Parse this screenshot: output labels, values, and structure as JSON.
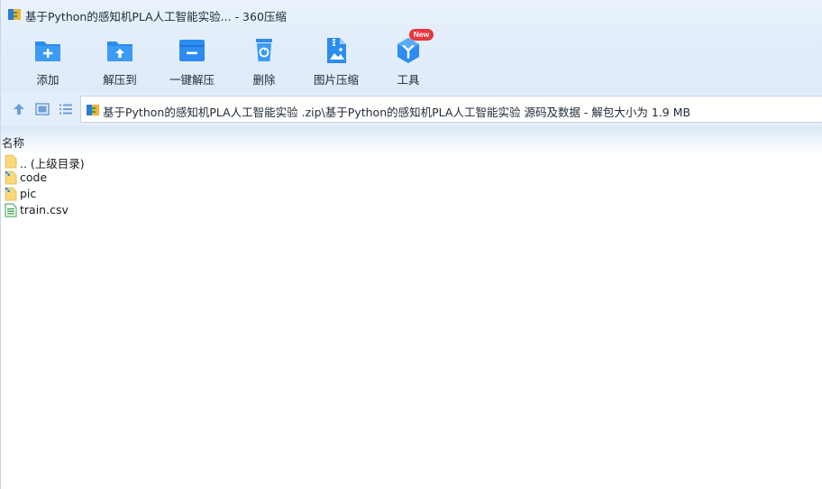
{
  "title_bar": {
    "title": "基于Python的感知机PLA人工智能实验...",
    "app_suffix": "- 360压缩",
    "icon": "archive-icon"
  },
  "toolbar": {
    "items": [
      {
        "label": "添加",
        "icon": "folder-add-icon"
      },
      {
        "label": "解压到",
        "icon": "folder-extract-icon"
      },
      {
        "label": "一键解压",
        "icon": "folder-minus-icon"
      },
      {
        "label": "删除",
        "icon": "trash-icon"
      },
      {
        "label": "图片压缩",
        "icon": "image-zip-icon"
      },
      {
        "label": "工具",
        "icon": "tools-cube-icon"
      }
    ],
    "badge": "New"
  },
  "address_bar": {
    "path": "基于Python的感知机PLA人工智能实验 .zip\\基于Python的感知机PLA人工智能实验 源码及数据 - 解包大小为 1.9 MB",
    "icons": [
      "up-arrow-icon",
      "view-thumb-icon",
      "view-list-icon"
    ]
  },
  "file_list": {
    "column_name": "名称",
    "rows": [
      {
        "name": ".. (上级目录)",
        "icon": "parent-folder-icon"
      },
      {
        "name": "code",
        "icon": "folder-icon"
      },
      {
        "name": "pic",
        "icon": "folder-icon"
      },
      {
        "name": "train.csv",
        "icon": "csv-file-icon"
      }
    ]
  },
  "colors": {
    "accent_blue": "#2d8cf0",
    "toolbar_bg": "#e3eefa",
    "badge_red": "#e8363a",
    "folder_yellow": "#f7d97c"
  }
}
